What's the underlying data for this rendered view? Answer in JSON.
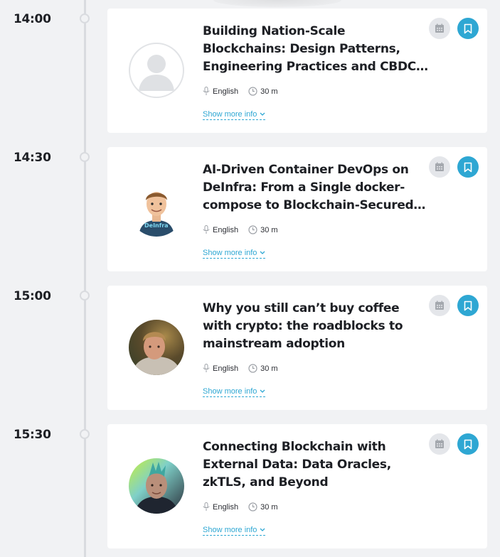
{
  "colors": {
    "accent": "#2ea7d3",
    "timeline": "#d9dbdf",
    "card_bg": "#ffffff",
    "page_bg": "#f1f2f4"
  },
  "sessions": [
    {
      "time": "14:00",
      "title": "Building Nation-Scale Blockchains: Design Patterns, Engineering Practices and CBDC Lessons",
      "language": "English",
      "duration": "30 m",
      "more": "Show more info",
      "avatar": "placeholder-avatar"
    },
    {
      "time": "14:30",
      "title": "AI-Driven Container DevOps on DeInfra: From a Single docker-compose to Blockchain-Secured…",
      "language": "English",
      "duration": "30 m",
      "more": "Show more info",
      "avatar": "cartoon-avatar",
      "avatar_shirt_text": "DeInfra"
    },
    {
      "time": "15:00",
      "title": "Why you still can’t buy coffee with crypto: the roadblocks to mainstream adoption",
      "language": "English",
      "duration": "30 m",
      "more": "Show more info",
      "avatar": "photo-avatar"
    },
    {
      "time": "15:30",
      "title": "Connecting Blockchain with External Data: Data Oracles, zkTLS, and Beyond",
      "language": "English",
      "duration": "30 m",
      "more": "Show more info",
      "avatar": "photo-avatar"
    }
  ],
  "icons": {
    "calendar": "calendar-icon",
    "bookmark": "bookmark-icon",
    "language": "microphone-icon",
    "duration": "clock-icon",
    "expand": "chevron-down-icon"
  }
}
